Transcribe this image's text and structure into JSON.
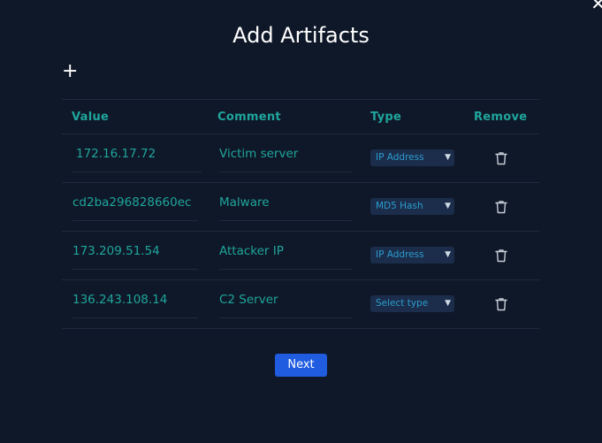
{
  "dialog": {
    "title": "Add Artifacts",
    "close_icon": "close-icon",
    "add_icon": "plus-icon"
  },
  "table": {
    "headers": [
      "Value",
      "Comment",
      "Type",
      "Remove"
    ],
    "rows": [
      {
        "value": "172.16.17.72",
        "comment": "Victim server",
        "type": "IP Address"
      },
      {
        "value": "cd2ba296828660ec",
        "comment": "Malware",
        "type": "MD5 Hash"
      },
      {
        "value": "173.209.51.54",
        "comment": "Attacker IP",
        "type": "IP Address"
      },
      {
        "value": "136.243.108.14",
        "comment": "C2 Server",
        "type": "Select type"
      }
    ],
    "remove_icon": "trash-icon"
  },
  "footer": {
    "next_label": "Next"
  },
  "colors": {
    "background": "#0f1828",
    "accent": "#1fa59c",
    "select_bg": "#1b2d4a",
    "button": "#1f5ce0"
  }
}
